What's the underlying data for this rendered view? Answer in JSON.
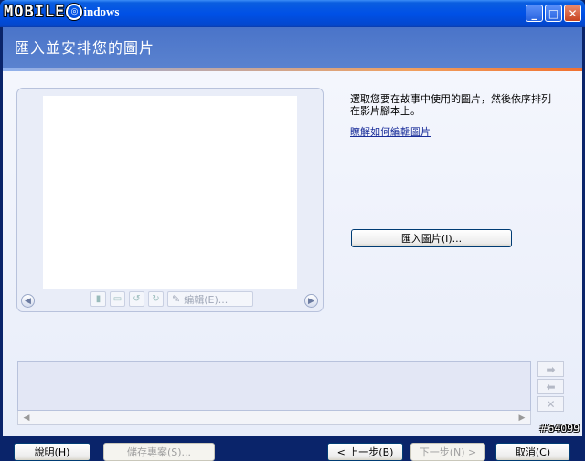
{
  "window": {
    "title_logo": "MOBILE",
    "title_suffix": "indows",
    "minimize_glyph": "_",
    "maximize_glyph": "□",
    "close_glyph": "✕"
  },
  "header": {
    "title": "匯入並安排您的圖片"
  },
  "preview": {
    "edit_label": "編輯(E)..."
  },
  "instructions": {
    "text": "選取您要在故事中使用的圖片，然後依序排列在影片腳本上。",
    "link": "瞭解如何編輯圖片"
  },
  "import_button": "匯入圖片(I)...",
  "footer": {
    "help": "說明(H)",
    "save": "儲存專案(S)...",
    "back": "< 上一步(B)",
    "next": "下一步(N) >",
    "cancel": "取消(C)"
  },
  "watermark": "#64099",
  "icons": {
    "nav_left": "chevron-left-icon",
    "nav_right": "chevron-right-icon",
    "move_right": "arrow-right-icon",
    "move_left": "arrow-left-icon",
    "remove": "delete-x-icon"
  },
  "colors": {
    "titlebar": "#0050e6",
    "header": "#4a74c9",
    "accent_line": "#f07030",
    "body": "#eef1fa"
  }
}
